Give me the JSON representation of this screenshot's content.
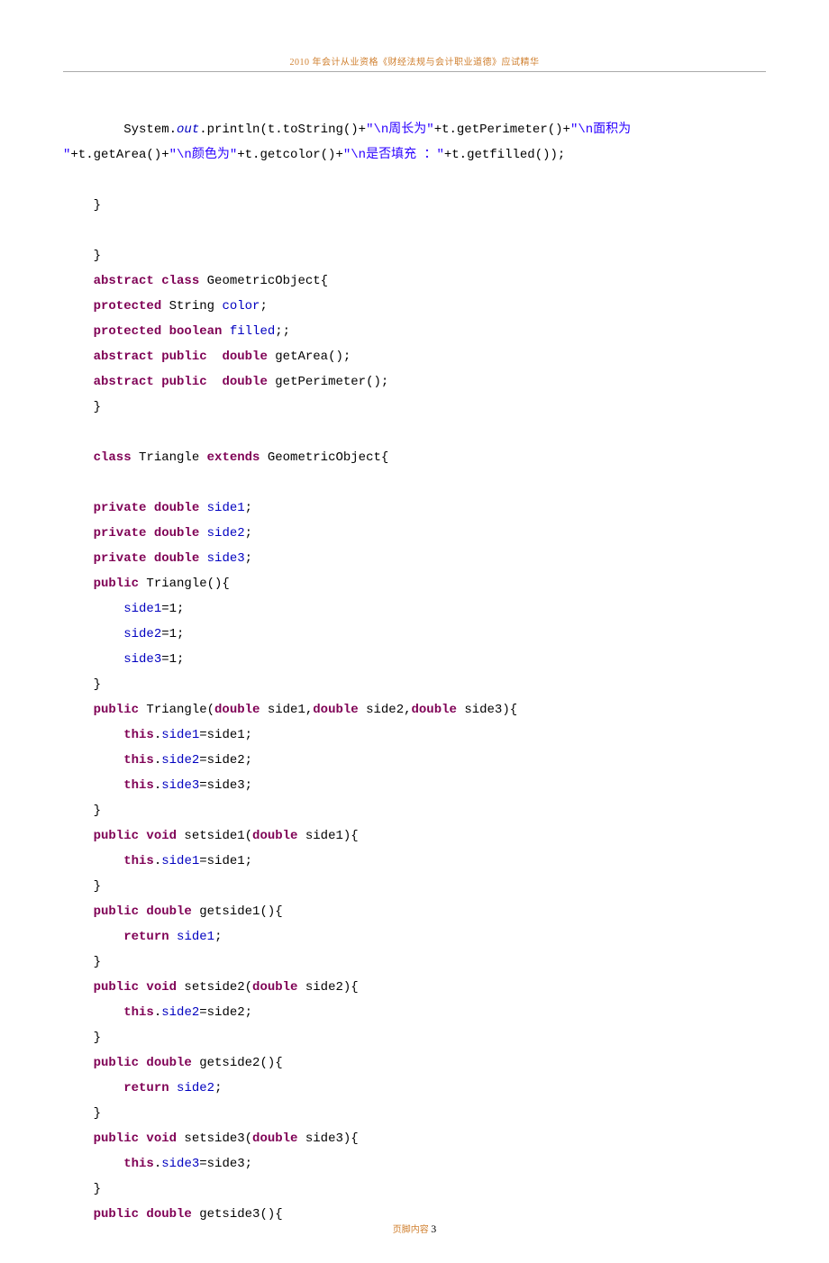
{
  "header": "2010 年会计从业资格《财经法规与会计职业道德》应试精华",
  "footer_label": "页脚内容",
  "footer_page": "3",
  "code": {
    "l01a": "        System.",
    "l01b": "out",
    "l01c": ".println(t.toString()+",
    "l01d": "\"\\n周长为\"",
    "l01e": "+t.getPerimeter()+",
    "l01f": "\"\\n面积为",
    "l02a": "\"",
    "l02b": "+t.getArea()+",
    "l02c": "\"\\n颜色为\"",
    "l02d": "+t.getcolor()+",
    "l02e": "\"\\n是否填充 ：\"",
    "l02f": "+t.getfilled());",
    "l03": "    }",
    "l04": "    }",
    "l05a": "    abstract",
    "l05b": " class",
    "l05c": " GeometricObject{",
    "l06a": "    protected",
    "l06b": " String ",
    "l06c": "color",
    "l06d": ";",
    "l07a": "    protected",
    "l07b": " boolean",
    "l07c": " ",
    "l07d": "filled",
    "l07e": ";;",
    "l08a": "    abstract",
    "l08b": " public",
    "l08c": "  double",
    "l08d": " getArea();",
    "l09a": "    abstract",
    "l09b": " public",
    "l09c": "  double",
    "l09d": " getPerimeter();",
    "l10": "    }",
    "l11a": "    class",
    "l11b": " Triangle ",
    "l11c": "extends",
    "l11d": " GeometricObject{",
    "l12a": "    private",
    "l12b": " double",
    "l12c": " ",
    "l12d": "side1",
    "l12e": ";",
    "l13a": "    private",
    "l13b": " double",
    "l13c": " ",
    "l13d": "side2",
    "l13e": ";",
    "l14a": "    private",
    "l14b": " double",
    "l14c": " ",
    "l14d": "side3",
    "l14e": ";",
    "l15a": "    public",
    "l15b": " Triangle(){",
    "l16a": "        ",
    "l16b": "side1",
    "l16c": "=1;",
    "l17a": "        ",
    "l17b": "side2",
    "l17c": "=1;",
    "l18a": "        ",
    "l18b": "side3",
    "l18c": "=1;",
    "l19": "    }",
    "l20a": "    public",
    "l20b": " Triangle(",
    "l20c": "double",
    "l20d": " side1,",
    "l20e": "double",
    "l20f": " side2,",
    "l20g": "double",
    "l20h": " side3){",
    "l21a": "        ",
    "l21b": "this",
    "l21c": ".",
    "l21d": "side1",
    "l21e": "=side1;",
    "l22a": "        ",
    "l22b": "this",
    "l22c": ".",
    "l22d": "side2",
    "l22e": "=side2;",
    "l23a": "        ",
    "l23b": "this",
    "l23c": ".",
    "l23d": "side3",
    "l23e": "=side3;",
    "l24": "    }",
    "l25a": "    public",
    "l25b": " void",
    "l25c": " setside1(",
    "l25d": "double",
    "l25e": " side1){",
    "l26a": "        ",
    "l26b": "this",
    "l26c": ".",
    "l26d": "side1",
    "l26e": "=side1;",
    "l27": "    }",
    "l28a": "    public",
    "l28b": " double",
    "l28c": " getside1(){",
    "l29a": "        ",
    "l29b": "return",
    "l29c": " ",
    "l29d": "side1",
    "l29e": ";",
    "l30": "    }",
    "l31a": "    public",
    "l31b": " void",
    "l31c": " setside2(",
    "l31d": "double",
    "l31e": " side2){",
    "l32a": "        ",
    "l32b": "this",
    "l32c": ".",
    "l32d": "side2",
    "l32e": "=side2;",
    "l33": "    }",
    "l34a": "    public",
    "l34b": " double",
    "l34c": " getside2(){",
    "l35a": "        ",
    "l35b": "return",
    "l35c": " ",
    "l35d": "side2",
    "l35e": ";",
    "l36": "    }",
    "l37a": "    public",
    "l37b": " void",
    "l37c": " setside3(",
    "l37d": "double",
    "l37e": " side3){",
    "l38a": "        ",
    "l38b": "this",
    "l38c": ".",
    "l38d": "side3",
    "l38e": "=side3;",
    "l39": "    }",
    "l40a": "    public",
    "l40b": " double",
    "l40c": " getside3(){"
  }
}
